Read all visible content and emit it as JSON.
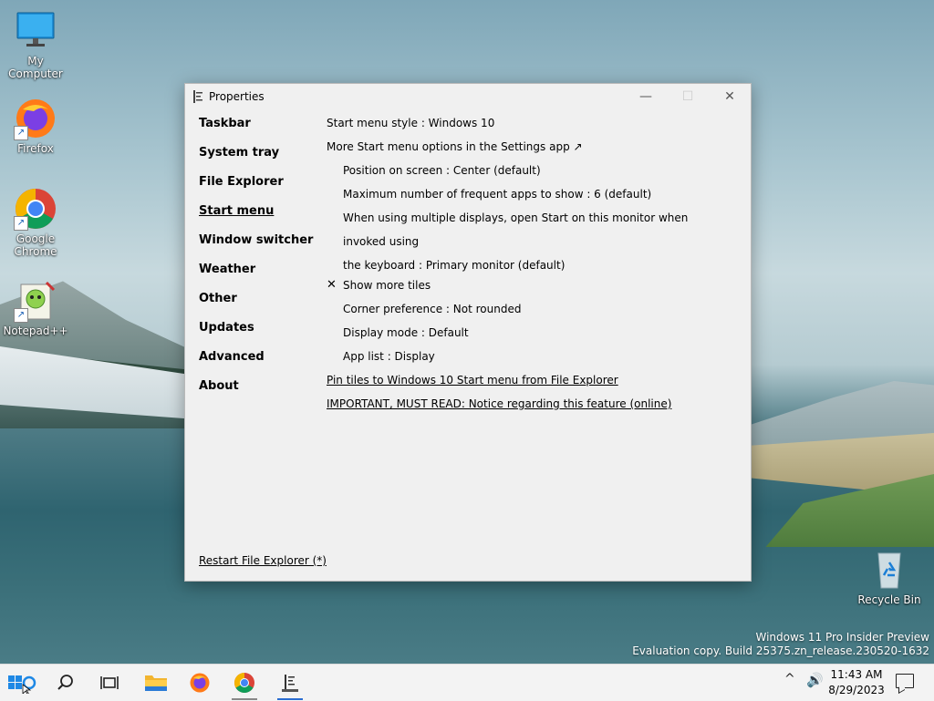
{
  "desktop": {
    "icons": [
      {
        "label": "My Computer"
      },
      {
        "label": "Firefox"
      },
      {
        "label": "Google Chrome"
      },
      {
        "label": "Notepad++"
      },
      {
        "label": "Recycle Bin"
      }
    ],
    "watermark": {
      "line1": "Windows 11 Pro Insider Preview",
      "line2": "Evaluation copy. Build 25375.zn_release.230520-1632"
    }
  },
  "window": {
    "title": "Properties",
    "controls": {
      "minimize": "—",
      "maximize": "☐",
      "close": "✕"
    },
    "nav": [
      {
        "label": "Taskbar"
      },
      {
        "label": "System tray"
      },
      {
        "label": "File Explorer"
      },
      {
        "label": "Start menu",
        "active": true
      },
      {
        "label": "Window switcher"
      },
      {
        "label": "Weather"
      },
      {
        "label": "Other"
      },
      {
        "label": "Updates"
      },
      {
        "label": "Advanced"
      },
      {
        "label": "About"
      }
    ],
    "content": {
      "start_menu_style": "Start menu style : Windows 10",
      "more_options": "More Start menu options in the Settings app ↗",
      "position": "Position on screen : Center (default)",
      "max_frequent": "Maximum number of frequent apps to show : 6 (default)",
      "multi_display_1": "When using multiple displays, open Start on this monitor when invoked using",
      "multi_display_2": "the keyboard : Primary monitor (default)",
      "show_more_tiles_mark": "✕",
      "show_more_tiles": "Show more tiles",
      "corner_pref": "Corner preference : Not rounded",
      "display_mode": "Display mode : Default",
      "app_list": "App list : Display",
      "pin_tiles_link": "Pin tiles to Windows 10 Start menu from File Explorer",
      "important_link": "IMPORTANT, MUST READ: Notice regarding this feature (online)"
    },
    "restart_link": "Restart File Explorer (*)"
  },
  "taskbar": {
    "clock_time": "11:43 AM",
    "clock_date": "8/29/2023",
    "tray_chevron": "^",
    "volume": "🔊"
  }
}
